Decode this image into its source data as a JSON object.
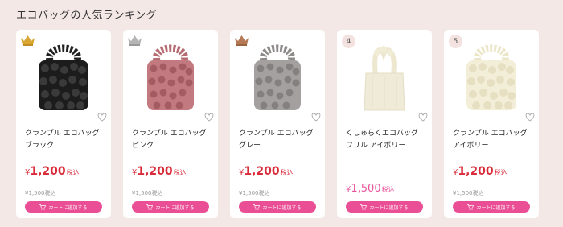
{
  "section": {
    "title": "エコバッグの人気ランキング"
  },
  "colors": {
    "accent": "#ea4f95",
    "price": "#d92b3a",
    "sale": "#e8559c",
    "background": "#f3e8e6"
  },
  "products": [
    {
      "rank": "1",
      "rank_icon": "gold-crown-icon",
      "name": "クランプル エコバッグ\nブラック",
      "price_prefix": "¥",
      "price": "1,200",
      "tax_label": "税込",
      "original_price": "¥1,500税込",
      "cart_label": "カートに追加する"
    },
    {
      "rank": "2",
      "rank_icon": "silver-crown-icon",
      "name": "クランプル エコバッグ\nピンク",
      "price_prefix": "¥",
      "price": "1,200",
      "tax_label": "税込",
      "original_price": "¥1,500税込",
      "cart_label": "カートに追加する"
    },
    {
      "rank": "3",
      "rank_icon": "bronze-crown-icon",
      "name": "クランプル エコバッグ\nグレー",
      "price_prefix": "¥",
      "price": "1,200",
      "tax_label": "税込",
      "original_price": "¥1,500税込",
      "cart_label": "カートに追加する"
    },
    {
      "rank": "4",
      "name": "くしゅらくエコバッグ\nフリル アイボリー",
      "price_prefix": "¥",
      "price": "1,500",
      "tax_label": "税込",
      "cart_label": "カートに追加する"
    },
    {
      "rank": "5",
      "name": "クランプル エコバッグ\nアイボリー",
      "price_prefix": "¥",
      "price": "1,200",
      "tax_label": "税込",
      "original_price": "¥1,500税込",
      "cart_label": "カートに追加する"
    }
  ]
}
